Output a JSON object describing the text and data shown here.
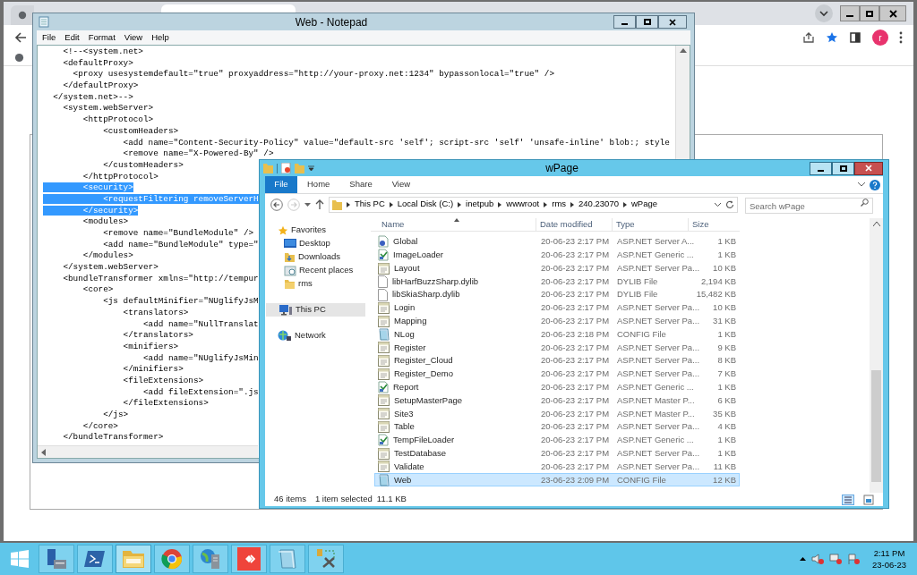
{
  "browser": {
    "profile_initial": "r"
  },
  "notepad": {
    "title": "Web - Notepad",
    "menu": [
      "File",
      "Edit",
      "Format",
      "View",
      "Help"
    ],
    "lines": [
      {
        "text": "    <!--<system.net>",
        "selected": false
      },
      {
        "text": "    <defaultProxy>",
        "selected": false
      },
      {
        "text": "      <proxy usesystemdefault=\"true\" proxyaddress=\"http://your-proxy.net:1234\" bypassonlocal=\"true\" />",
        "selected": false
      },
      {
        "text": "    </defaultProxy>",
        "selected": false
      },
      {
        "text": "  </system.net>-->",
        "selected": false
      },
      {
        "text": "    <system.webServer>",
        "selected": false
      },
      {
        "text": "        <httpProtocol>",
        "selected": false
      },
      {
        "text": "            <customHeaders>",
        "selected": false
      },
      {
        "text": "                <add name=\"Content-Security-Policy\" value=\"default-src 'self'; script-src 'self' 'unsafe-inline' blob:; style",
        "selected": false
      },
      {
        "text": "                <remove name=\"X-Powered-By\" />",
        "selected": false
      },
      {
        "text": "            </customHeaders>",
        "selected": false
      },
      {
        "text": "        </httpProtocol>",
        "selected": false
      },
      {
        "text": "        <security>",
        "selected": true
      },
      {
        "text": "            <requestFiltering removeServerH",
        "selected": true
      },
      {
        "text": "        </security>",
        "selected": true
      },
      {
        "text": "        <modules>",
        "selected": false
      },
      {
        "text": "            <remove name=\"BundleModule\" />",
        "selected": false
      },
      {
        "text": "            <add name=\"BundleModule\" type=\"",
        "selected": false
      },
      {
        "text": "        </modules>",
        "selected": false
      },
      {
        "text": "    </system.webServer>",
        "selected": false
      },
      {
        "text": "    <bundleTransformer xmlns=\"http://tempur",
        "selected": false
      },
      {
        "text": "        <core>",
        "selected": false
      },
      {
        "text": "            <js defaultMinifier=\"NUglifyJsM",
        "selected": false
      },
      {
        "text": "                <translators>",
        "selected": false
      },
      {
        "text": "                    <add name=\"NullTranslat",
        "selected": false
      },
      {
        "text": "                </translators>",
        "selected": false
      },
      {
        "text": "                <minifiers>",
        "selected": false
      },
      {
        "text": "                    <add name=\"NUglifyJsMin",
        "selected": false
      },
      {
        "text": "                </minifiers>",
        "selected": false
      },
      {
        "text": "                <fileExtensions>",
        "selected": false
      },
      {
        "text": "                    <add fileExtension=\".js",
        "selected": false
      },
      {
        "text": "                </fileExtensions>",
        "selected": false
      },
      {
        "text": "            </js>",
        "selected": false
      },
      {
        "text": "        </core>",
        "selected": false
      },
      {
        "text": "    </bundleTransformer>",
        "selected": false
      }
    ]
  },
  "explorer": {
    "title": "wPage",
    "ribbon_tabs": [
      {
        "label": "File",
        "selected": true
      },
      {
        "label": "Home",
        "selected": false
      },
      {
        "label": "Share",
        "selected": false
      },
      {
        "label": "View",
        "selected": false
      }
    ],
    "breadcrumb": [
      "This PC",
      "Local Disk (C:)",
      "inetpub",
      "wwwroot",
      "rms",
      "240.23070",
      "wPage"
    ],
    "search": {
      "placeholder": "Search wPage"
    },
    "nav": [
      {
        "label": "Favorites",
        "kind": "star",
        "selected": false,
        "children": [
          {
            "label": "Desktop",
            "kind": "desktop",
            "selected": false
          },
          {
            "label": "Downloads",
            "kind": "downloads",
            "selected": false
          },
          {
            "label": "Recent places",
            "kind": "recent",
            "selected": false
          },
          {
            "label": "rms",
            "kind": "folder",
            "selected": false
          }
        ]
      },
      {
        "label": "This PC",
        "kind": "pc",
        "selected": true
      },
      {
        "label": "Network",
        "kind": "network",
        "selected": false
      }
    ],
    "columns": [
      "Name",
      "Date modified",
      "Type",
      "Size"
    ],
    "rows": [
      {
        "name": "Global",
        "date": "20-06-23 2:17 PM",
        "type": "ASP.NET Server A...",
        "size": "1 KB",
        "kind": "asax",
        "selected": false
      },
      {
        "name": "ImageLoader",
        "date": "20-06-23 2:17 PM",
        "type": "ASP.NET Generic ...",
        "size": "1 KB",
        "kind": "handler",
        "selected": false
      },
      {
        "name": "Layout",
        "date": "20-06-23 2:17 PM",
        "type": "ASP.NET Server Pa...",
        "size": "10 KB",
        "kind": "page",
        "selected": false
      },
      {
        "name": "libHarfBuzzSharp.dylib",
        "date": "20-06-23 2:17 PM",
        "type": "DYLIB File",
        "size": "2,194 KB",
        "kind": "file",
        "selected": false
      },
      {
        "name": "libSkiaSharp.dylib",
        "date": "20-06-23 2:17 PM",
        "type": "DYLIB File",
        "size": "15,482 KB",
        "kind": "file",
        "selected": false
      },
      {
        "name": "Login",
        "date": "20-06-23 2:17 PM",
        "type": "ASP.NET Server Pa...",
        "size": "10 KB",
        "kind": "page",
        "selected": false
      },
      {
        "name": "Mapping",
        "date": "20-06-23 2:17 PM",
        "type": "ASP.NET Server Pa...",
        "size": "31 KB",
        "kind": "page",
        "selected": false
      },
      {
        "name": "NLog",
        "date": "20-06-23 2:18 PM",
        "type": "CONFIG File",
        "size": "1 KB",
        "kind": "config",
        "selected": false
      },
      {
        "name": "Register",
        "date": "20-06-23 2:17 PM",
        "type": "ASP.NET Server Pa...",
        "size": "9 KB",
        "kind": "page",
        "selected": false
      },
      {
        "name": "Register_Cloud",
        "date": "20-06-23 2:17 PM",
        "type": "ASP.NET Server Pa...",
        "size": "8 KB",
        "kind": "page",
        "selected": false
      },
      {
        "name": "Register_Demo",
        "date": "20-06-23 2:17 PM",
        "type": "ASP.NET Server Pa...",
        "size": "7 KB",
        "kind": "page",
        "selected": false
      },
      {
        "name": "Report",
        "date": "20-06-23 2:17 PM",
        "type": "ASP.NET Generic ...",
        "size": "1 KB",
        "kind": "handler",
        "selected": false
      },
      {
        "name": "SetupMasterPage",
        "date": "20-06-23 2:17 PM",
        "type": "ASP.NET Master P...",
        "size": "6 KB",
        "kind": "page",
        "selected": false
      },
      {
        "name": "Site3",
        "date": "20-06-23 2:17 PM",
        "type": "ASP.NET Master P...",
        "size": "35 KB",
        "kind": "page",
        "selected": false
      },
      {
        "name": "Table",
        "date": "20-06-23 2:17 PM",
        "type": "ASP.NET Server Pa...",
        "size": "4 KB",
        "kind": "page",
        "selected": false
      },
      {
        "name": "TempFileLoader",
        "date": "20-06-23 2:17 PM",
        "type": "ASP.NET Generic ...",
        "size": "1 KB",
        "kind": "handler",
        "selected": false
      },
      {
        "name": "TestDatabase",
        "date": "20-06-23 2:17 PM",
        "type": "ASP.NET Server Pa...",
        "size": "1 KB",
        "kind": "page",
        "selected": false
      },
      {
        "name": "Validate",
        "date": "20-06-23 2:17 PM",
        "type": "ASP.NET Server Pa...",
        "size": "11 KB",
        "kind": "page",
        "selected": false
      },
      {
        "name": "Web",
        "date": "23-06-23 2:09 PM",
        "type": "CONFIG File",
        "size": "12 KB",
        "kind": "config",
        "selected": true
      }
    ],
    "status": {
      "count": "46 items",
      "selection": "1 item selected",
      "size": "11.1 KB"
    }
  },
  "taskbar": {
    "apps": [
      {
        "kind": "server",
        "selected": false
      },
      {
        "kind": "terminal",
        "selected": false
      },
      {
        "kind": "folder",
        "selected": true
      },
      {
        "kind": "browser",
        "selected": false
      },
      {
        "kind": "globe-server",
        "selected": false
      },
      {
        "kind": "remote",
        "selected": false
      },
      {
        "kind": "notepad",
        "selected": false
      },
      {
        "kind": "tools",
        "selected": false
      }
    ],
    "time": "2:11 PM",
    "date": "23-06-23"
  }
}
